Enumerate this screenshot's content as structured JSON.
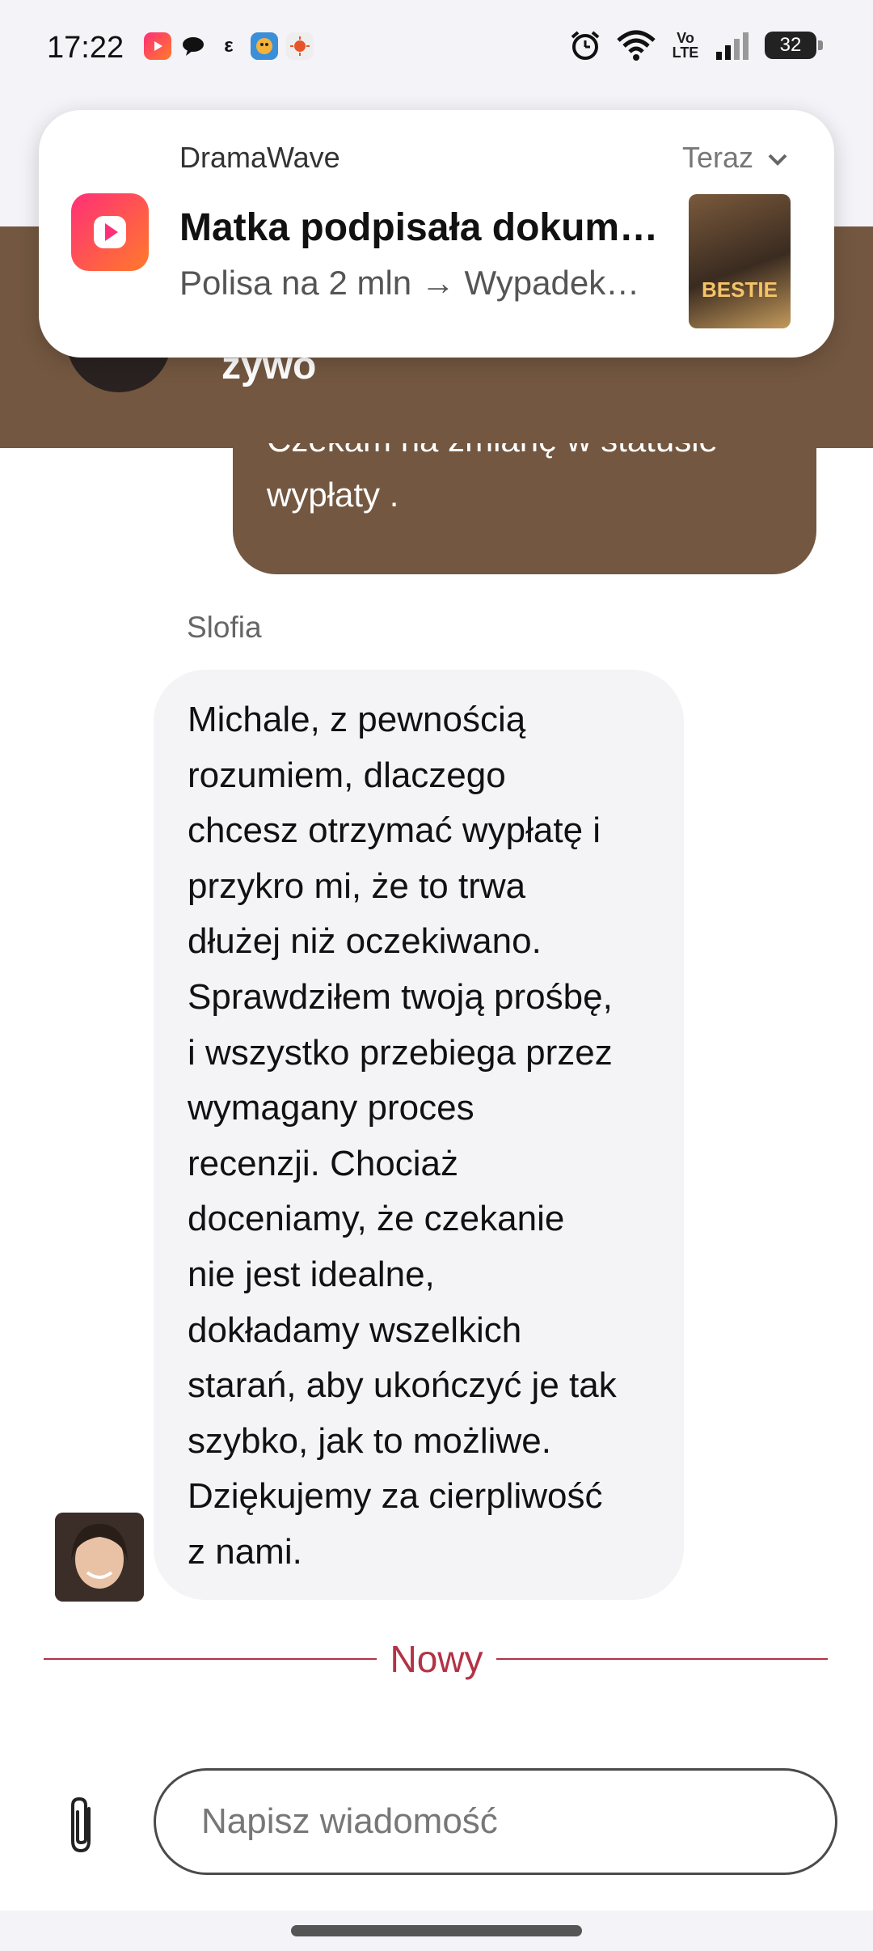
{
  "status_bar": {
    "time": "17:22",
    "left_icons": [
      "dramawave-icon",
      "chat-bubble-icon",
      "e-icon",
      "game-icon",
      "sun-icon"
    ],
    "right_icons": [
      "alarm-icon",
      "wifi-icon",
      "volte-icon",
      "signal-icon"
    ],
    "volte_label": "Vo LTE",
    "battery": "32"
  },
  "notification": {
    "app_name": "DramaWave",
    "time": "Teraz",
    "title": "Matka podpisała dokum…",
    "text": "Polisa na 2 mln → Wypadek…",
    "thumbnail_text": "BESTIE",
    "accent": "#ff2f78"
  },
  "header": {
    "title": "żywo",
    "color": "#735740"
  },
  "messages": {
    "outgoing_text": "Czekam na zmianę w statusie wypłaty .",
    "sender_name": "Slofia",
    "incoming_text": "Michale, z pewnością\nrozumiem, dlaczego\nchcesz otrzymać wypłatę i\nprzykro mi, że to trwa\ndłużej niż oczekiwano.\nSprawdziłem twoją prośbę,\ni wszystko przebiega przez\nwymagany proces\nrecenzji. Chociaż\ndoceniamy, że czekanie\nnie jest idealne,\ndokładamy wszelkich\nstarań, aby ukończyć je tak\nszybko, jak to możliwe.\nDziękujemy za cierpliwość\nz nami."
  },
  "divider": {
    "label": "Nowy",
    "color": "#b33246"
  },
  "composer": {
    "placeholder": "Napisz wiadomość",
    "value": ""
  }
}
